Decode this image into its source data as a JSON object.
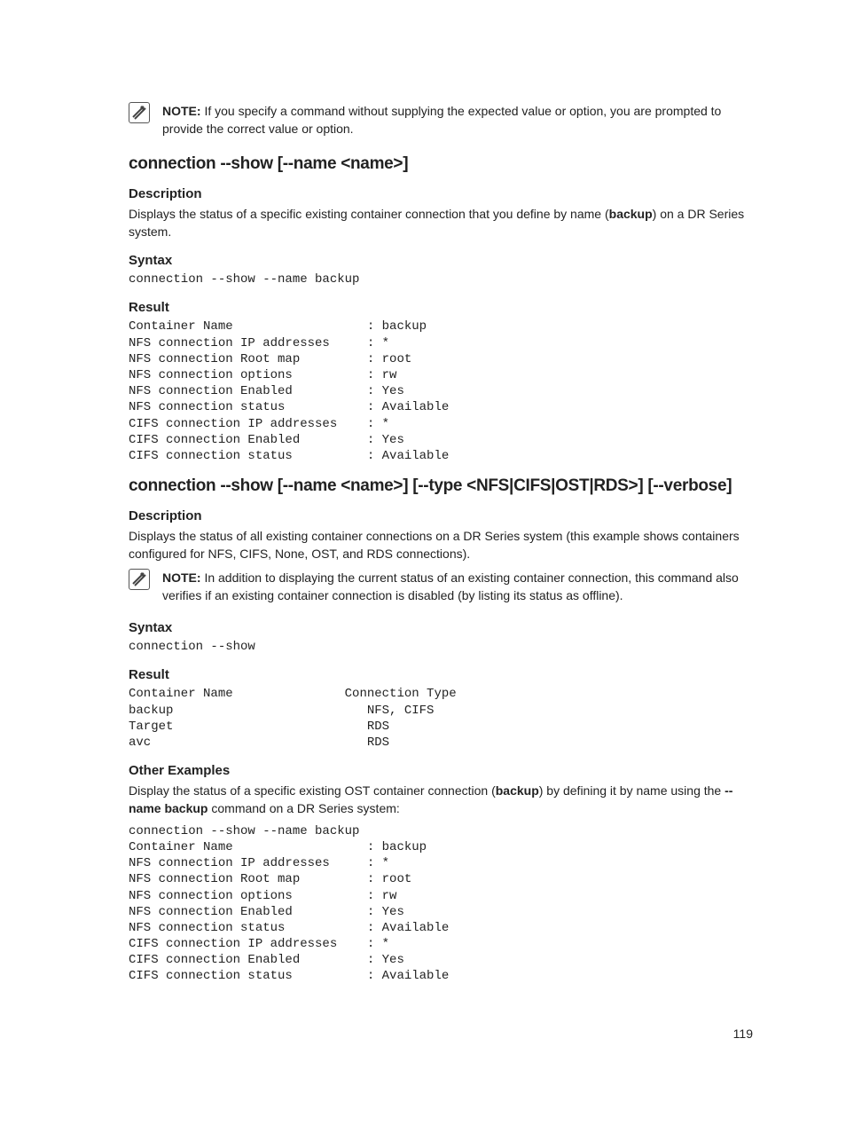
{
  "top_note": {
    "label": "NOTE:",
    "text": " If you specify a command without supplying the expected value or option, you are prompted to provide the correct value or option."
  },
  "section1": {
    "title": "connection --show [--name <name>]",
    "desc_h": "Description",
    "desc_t1": "Displays the status of a specific existing container connection that you define by name (",
    "desc_bold": "backup",
    "desc_t2": ") on a DR Series system.",
    "syntax_h": "Syntax",
    "syntax_code": "connection --show --name backup",
    "result_h": "Result",
    "result_code": "Container Name                  : backup\nNFS connection IP addresses     : *\nNFS connection Root map         : root\nNFS connection options          : rw\nNFS connection Enabled          : Yes\nNFS connection status           : Available\nCIFS connection IP addresses    : *\nCIFS connection Enabled         : Yes\nCIFS connection status          : Available"
  },
  "section2": {
    "title": "connection --show [--name <name>] [--type <NFS|CIFS|OST|RDS>] [--verbose]",
    "desc_h": "Description",
    "desc_t": "Displays the status of all existing container connections on a DR Series system (this example shows containers configured for NFS, CIFS, None, OST, and RDS connections).",
    "note_label": "NOTE:",
    "note_text": " In addition to displaying the current status of an existing container connection, this command also verifies if an existing container connection is disabled (by listing its status as offline).",
    "syntax_h": "Syntax",
    "syntax_code": "connection --show",
    "result_h": "Result",
    "result_code": "Container Name               Connection Type\nbackup                          NFS, CIFS\nTarget                          RDS\navc                             RDS",
    "other_h": "Other Examples",
    "other_t1": "Display the status of a specific existing OST container connection (",
    "other_bold1": "backup",
    "other_t2": ") by defining it by name using the ",
    "other_bold2": "--name backup",
    "other_t3": " command on a DR Series system:",
    "other_code": "connection --show --name backup\nContainer Name                  : backup\nNFS connection IP addresses     : *\nNFS connection Root map         : root\nNFS connection options          : rw\nNFS connection Enabled          : Yes\nNFS connection status           : Available\nCIFS connection IP addresses    : *\nCIFS connection Enabled         : Yes\nCIFS connection status          : Available"
  },
  "page_number": "119"
}
